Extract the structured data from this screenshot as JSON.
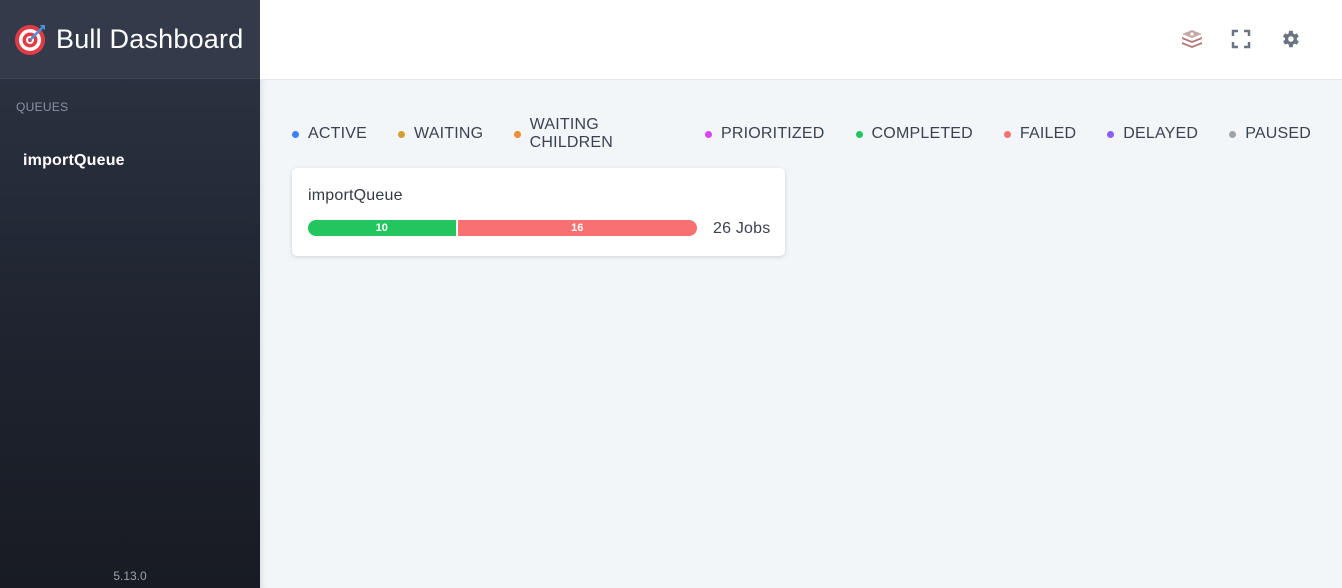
{
  "sidebar": {
    "brand": "Bull Dashboard",
    "section_title": "QUEUES",
    "queues": [
      {
        "label": "importQueue"
      }
    ],
    "version": "5.13.0"
  },
  "header": {
    "icons": [
      "redis-icon",
      "fullscreen-icon",
      "gear-icon"
    ]
  },
  "legend": [
    {
      "label": "ACTIVE",
      "color": "#3b82f6"
    },
    {
      "label": "WAITING",
      "color": "#d69e2e"
    },
    {
      "label": "WAITING CHILDREN",
      "color": "#f28c38"
    },
    {
      "label": "PRIORITIZED",
      "color": "#d946ef"
    },
    {
      "label": "COMPLETED",
      "color": "#22c55e"
    },
    {
      "label": "FAILED",
      "color": "#f87171"
    },
    {
      "label": "DELAYED",
      "color": "#8b5cf6"
    },
    {
      "label": "PAUSED",
      "color": "#a3a3a3"
    }
  ],
  "queue_card": {
    "name": "importQueue",
    "segments": [
      {
        "status": "completed",
        "count": "10"
      },
      {
        "status": "failed",
        "count": "16"
      }
    ],
    "total_label": "26 Jobs"
  }
}
